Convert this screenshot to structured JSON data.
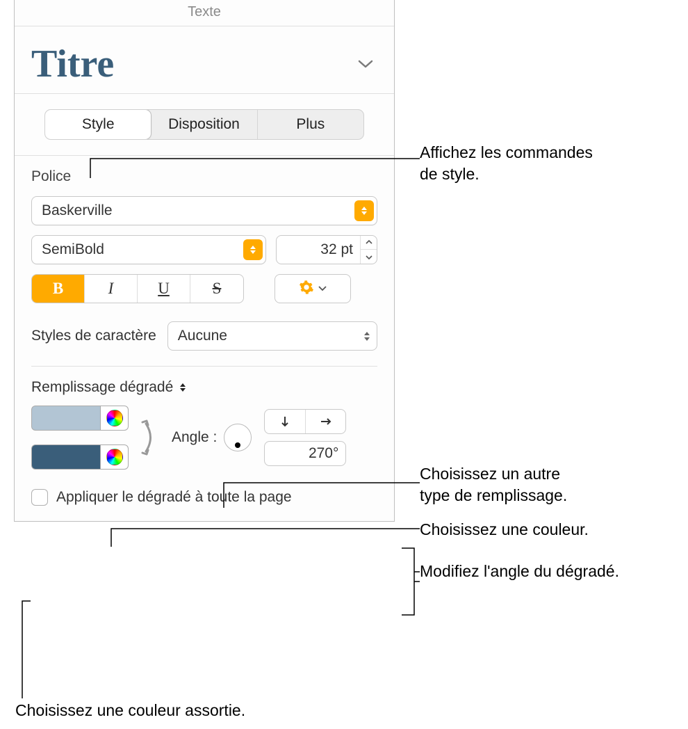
{
  "header": {
    "title": "Texte"
  },
  "title_block": {
    "sample": "Titre"
  },
  "tabs": {
    "style": "Style",
    "layout": "Disposition",
    "more": "Plus"
  },
  "font": {
    "label": "Police",
    "family": "Baskerville",
    "weight": "SemiBold",
    "size": "32 pt",
    "bold": "B",
    "italic": "I",
    "underline": "U",
    "strike": "S"
  },
  "char_style": {
    "label": "Styles de caractère",
    "value": "Aucune"
  },
  "fill": {
    "label": "Remplissage dégradé",
    "angle_label": "Angle :",
    "angle_value": "270°",
    "apply_label": "Appliquer le dégradé à toute la page",
    "color1": "#b2c5d4",
    "color2": "#3a5e7a"
  },
  "callouts": {
    "style": "Affichez les commandes\nde style.",
    "fill_type": "Choisissez un autre\ntype de remplissage.",
    "color": "Choisissez une couleur.",
    "angle": "Modifiez l'angle du dégradé.",
    "matching_color": "Choisissez une couleur assortie."
  }
}
